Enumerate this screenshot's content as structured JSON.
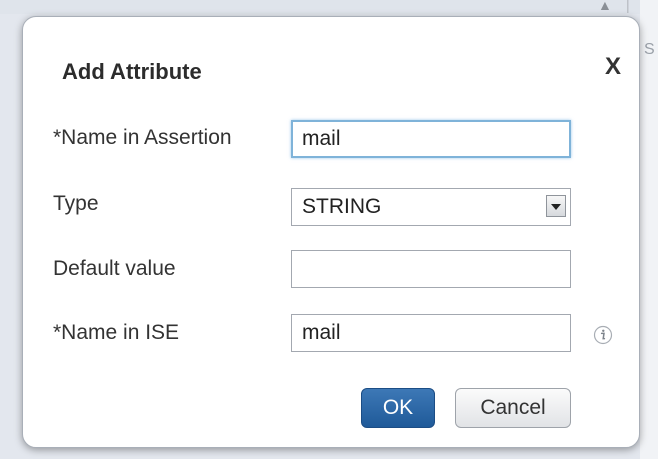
{
  "background": {
    "scroll_arrow": "▲",
    "separator": "|",
    "partial_letter": "S"
  },
  "dialog": {
    "title": "Add Attribute",
    "close_label": "X",
    "fields": {
      "name_in_assertion": {
        "label": "*Name in Assertion",
        "value": "mail"
      },
      "type": {
        "label": "Type",
        "value": "STRING"
      },
      "default_value": {
        "label": "Default value",
        "value": ""
      },
      "name_in_ise": {
        "label": "*Name in ISE",
        "value": "mail"
      }
    },
    "buttons": {
      "ok_label": "OK",
      "cancel_label": "Cancel"
    }
  },
  "colors": {
    "ok_button": "#2b68a8",
    "focus_border": "#7fb3d9",
    "dialog_border": "#a9afb8"
  },
  "icons": {
    "close": "close-icon",
    "dropdown": "chevron-down-icon",
    "info": "info-icon"
  }
}
